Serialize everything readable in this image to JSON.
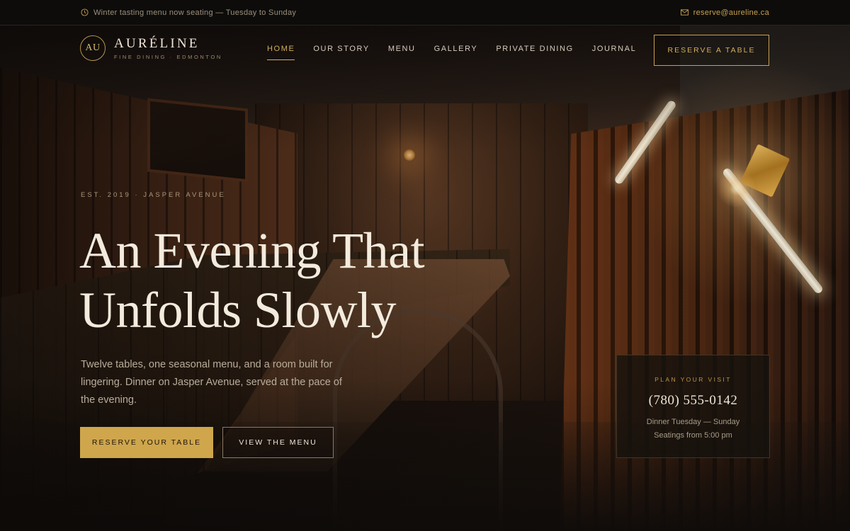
{
  "topbar": {
    "announcement": "Winter tasting menu now seating — Tuesday to Sunday",
    "email": "reserve@aureline.ca"
  },
  "brand": {
    "monogram": "AU",
    "name": "AURÉLINE",
    "tagline": "FINE DINING · EDMONTON"
  },
  "nav": {
    "items": [
      {
        "label": "HOME",
        "active": true
      },
      {
        "label": "OUR STORY"
      },
      {
        "label": "MENU"
      },
      {
        "label": "GALLERY"
      },
      {
        "label": "PRIVATE DINING"
      },
      {
        "label": "JOURNAL"
      }
    ],
    "reserve_label": "RESERVE A TABLE"
  },
  "hero": {
    "eyebrow": "EST. 2019 · JASPER AVENUE",
    "headline_line1": "An Evening That",
    "headline_line2": "Unfolds Slowly",
    "lede": "Twelve tables, one seasonal menu, and a room built for lingering. Dinner on Jasper Avenue, served at the pace of the evening.",
    "primary_cta": "RESERVE YOUR TABLE",
    "secondary_cta": "VIEW THE MENU"
  },
  "visit": {
    "label": "PLAN YOUR VISIT",
    "phone": "(780) 555-0142",
    "hours": "Dinner Tuesday — Sunday",
    "seatings": "Seatings from 5:00 pm"
  },
  "colors": {
    "accent_gold": "#cfa64c",
    "background": "#0c0a09",
    "text_cream": "#f3ebdd"
  },
  "icons": {
    "announcement": "clock-icon",
    "email": "mail-icon"
  }
}
